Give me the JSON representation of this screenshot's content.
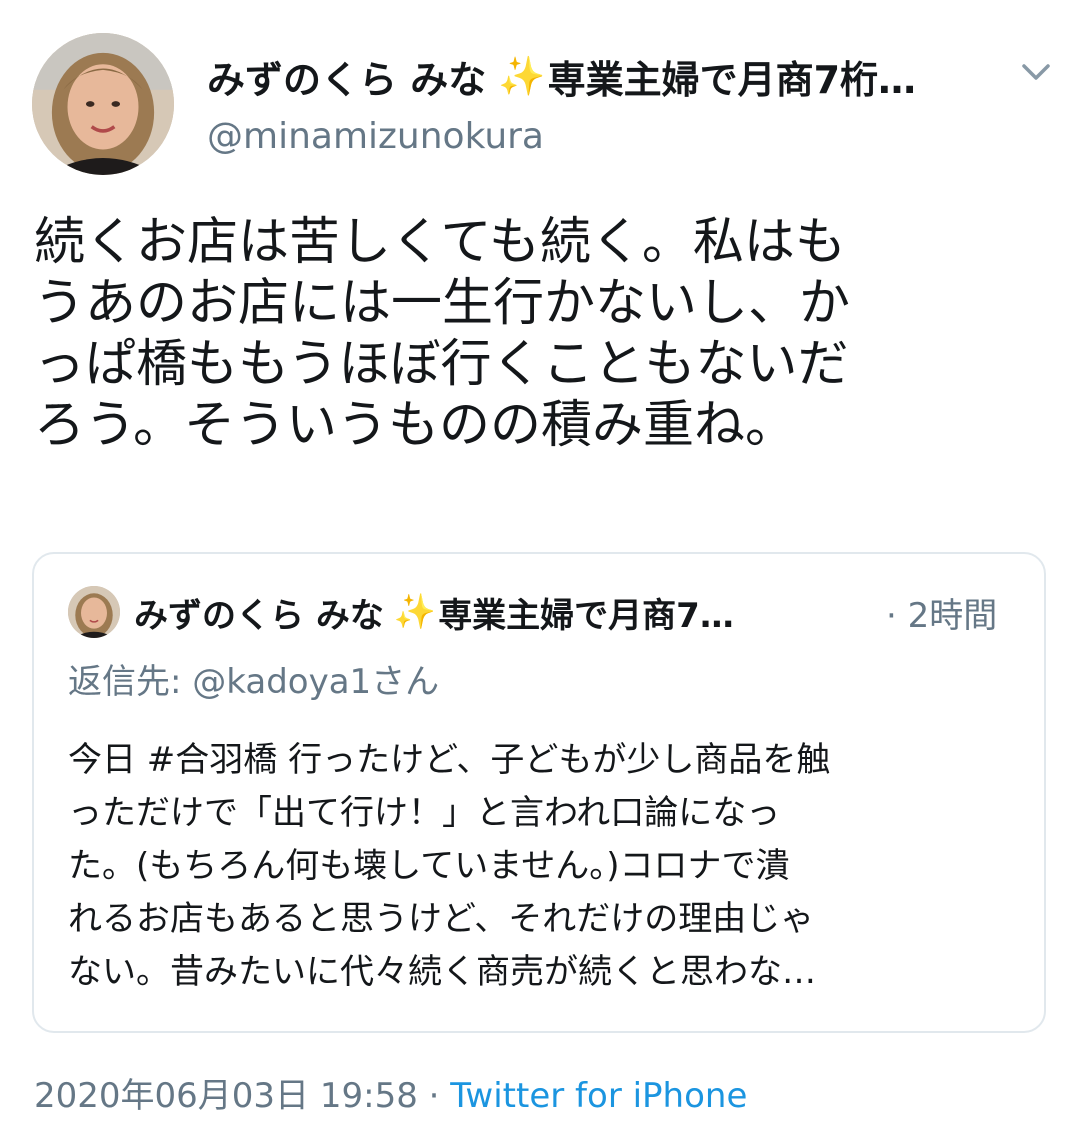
{
  "author": {
    "name": "みずのくら みな",
    "sparkle": "✨",
    "name_rest": "専業主婦で月商7桁…",
    "handle": "@minamizunokura"
  },
  "tweet": {
    "lines": [
      "続くお店は苦しくても続く。私はも",
      "うあのお店には一生行かないし、か",
      "っぱ橋ももうほぼ行くこともないだ",
      "ろう。そういうものの積み重ね。"
    ]
  },
  "quoted": {
    "name": "みずのくら みな",
    "sparkle": "✨",
    "name_rest": "専業主婦で月商7…",
    "time": "· 2時間",
    "reply_to": "返信先: @kadoya1さん",
    "lines": [
      "今日 #合羽橋 行ったけど、子どもが少し商品を触",
      "っただけで「出て行け！」と言われ口論になっ",
      "た。(もちろん何も壊していません。)コロナで潰",
      "れるお店もあると思うけど、それだけの理由じゃ",
      "ない。昔みたいに代々続く商売が続くと思わな…"
    ]
  },
  "footer": {
    "datetime": "2020年06月03日 19:58 · ",
    "source": "Twitter for iPhone"
  },
  "colors": {
    "secondary_text": "#657786",
    "link": "#1b95e0",
    "border": "#e1e8ed"
  },
  "icons": {
    "menu": "chevron-down-icon",
    "sparkle": "sparkles-icon"
  }
}
